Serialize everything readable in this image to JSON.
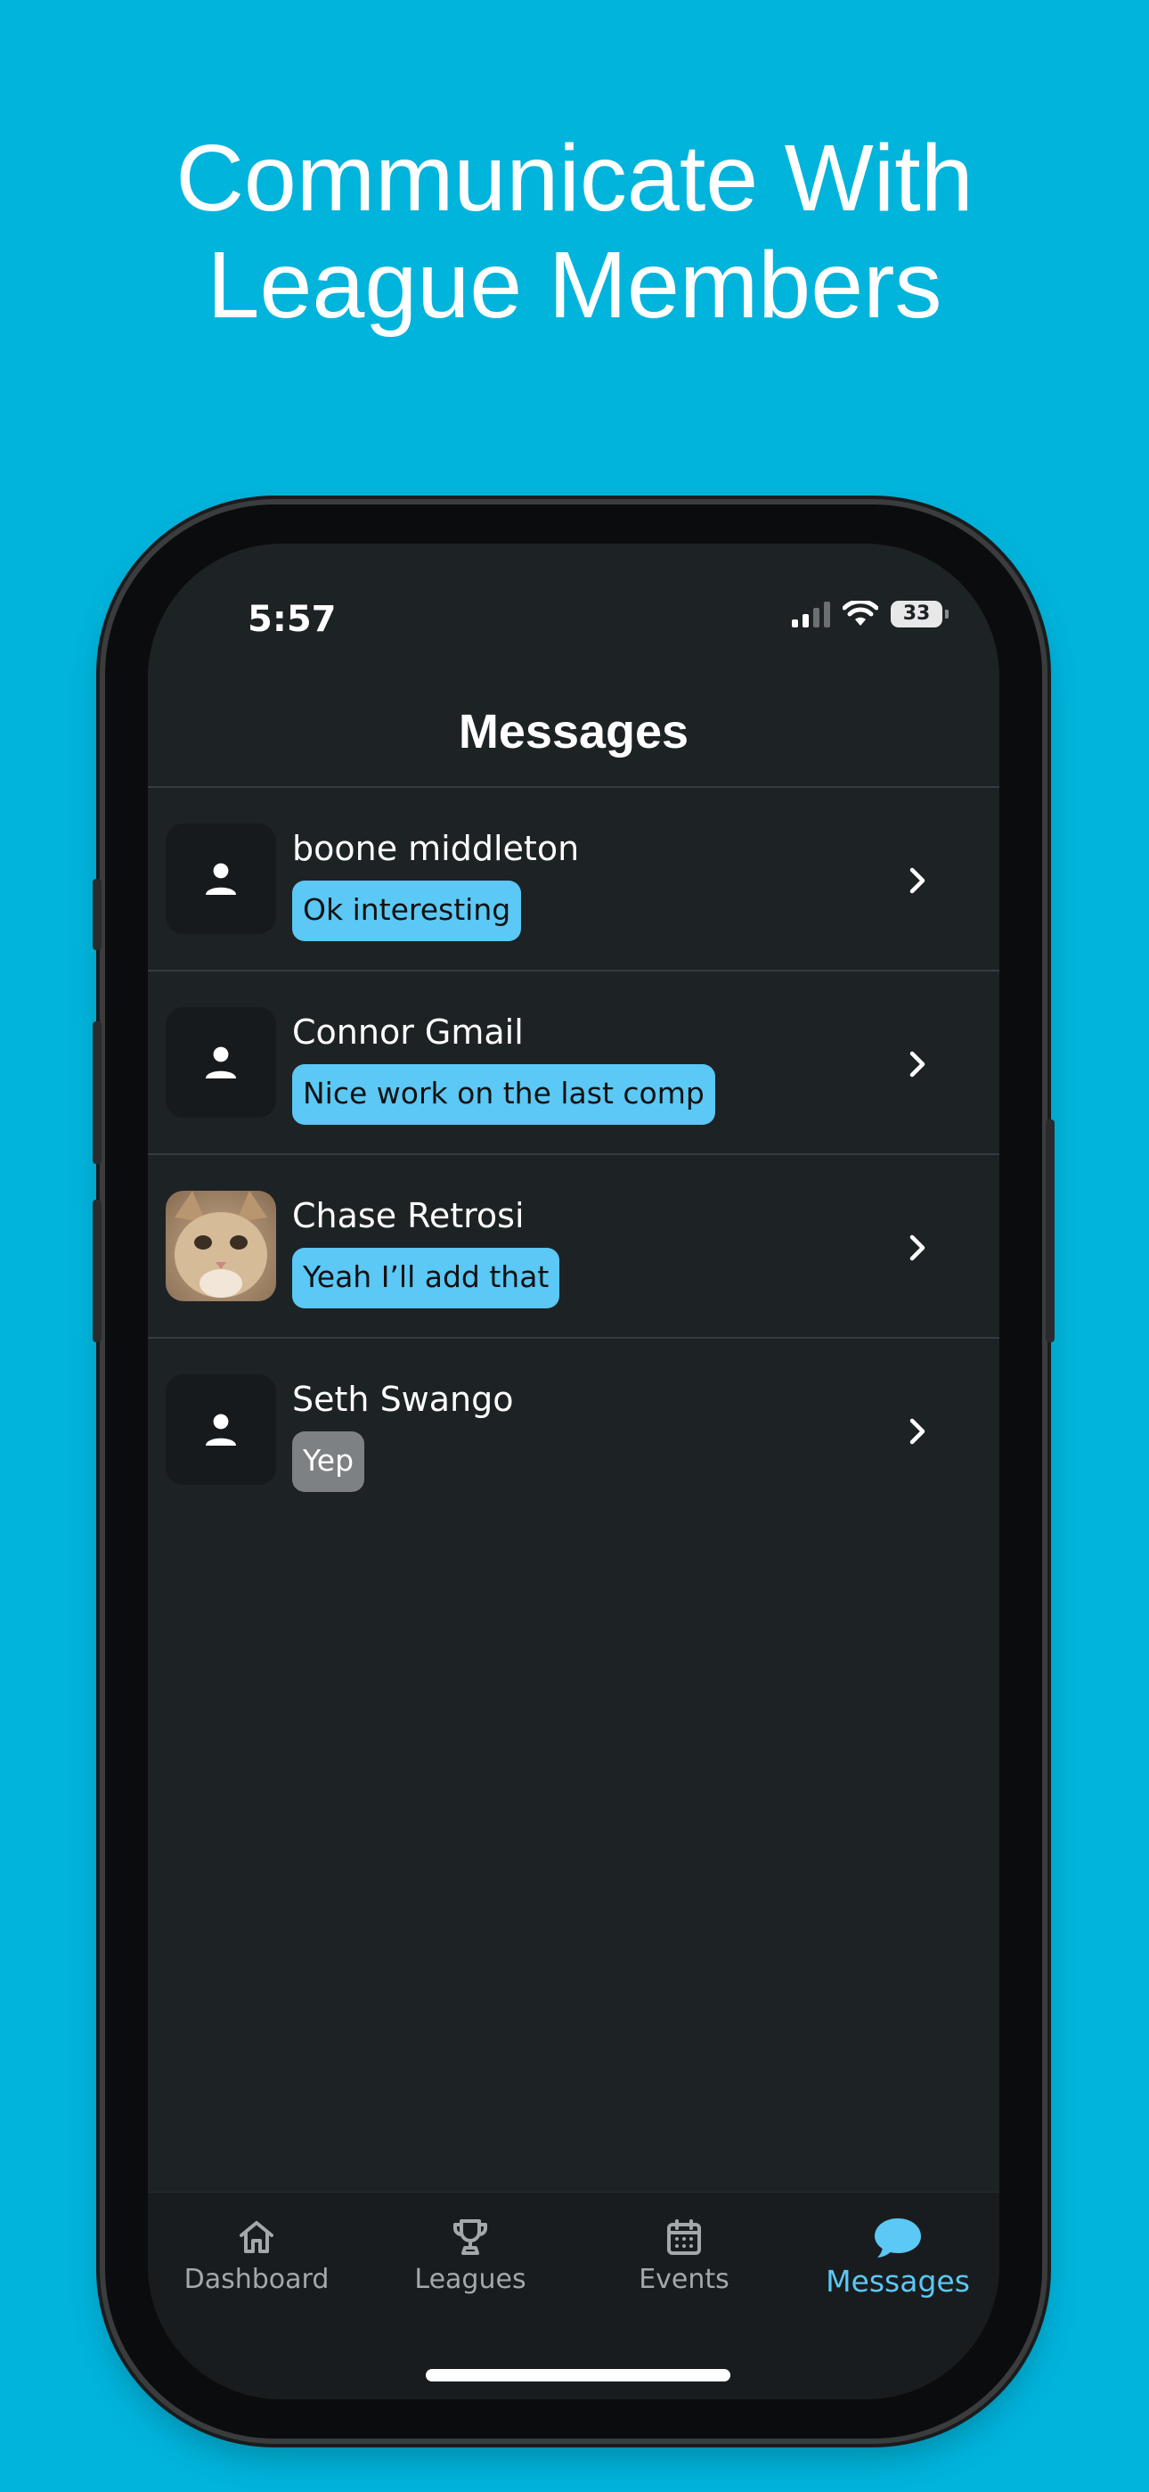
{
  "headline": {
    "line1": "Communicate With",
    "line2": "League Members"
  },
  "status_bar": {
    "time": "5:57",
    "battery": "33"
  },
  "screen_title": "Messages",
  "conversations": [
    {
      "name": "boone middleton",
      "last_message": "Ok interesting",
      "unread": true,
      "avatar": "person-icon"
    },
    {
      "name": "Connor Gmail",
      "last_message": "Nice work on the last comp",
      "unread": true,
      "avatar": "person-icon"
    },
    {
      "name": "Chase Retrosi",
      "last_message": "Yeah I’ll add that",
      "unread": true,
      "avatar": "cat-photo"
    },
    {
      "name": "Seth Swango",
      "last_message": "Yep",
      "unread": false,
      "avatar": "person-icon"
    }
  ],
  "tabs": [
    {
      "label": "Dashboard",
      "icon": "home-icon",
      "active": false
    },
    {
      "label": "Leagues",
      "icon": "trophy-icon",
      "active": false
    },
    {
      "label": "Events",
      "icon": "calendar-icon",
      "active": false
    },
    {
      "label": "Messages",
      "icon": "chat-bubble-icon",
      "active": true
    }
  ],
  "colors": {
    "background": "#00b4dc",
    "screen": "#1d2225",
    "unread_bubble": "#5bc8f5",
    "read_bubble": "#7e8184",
    "active_tab": "#5bc8f5"
  }
}
